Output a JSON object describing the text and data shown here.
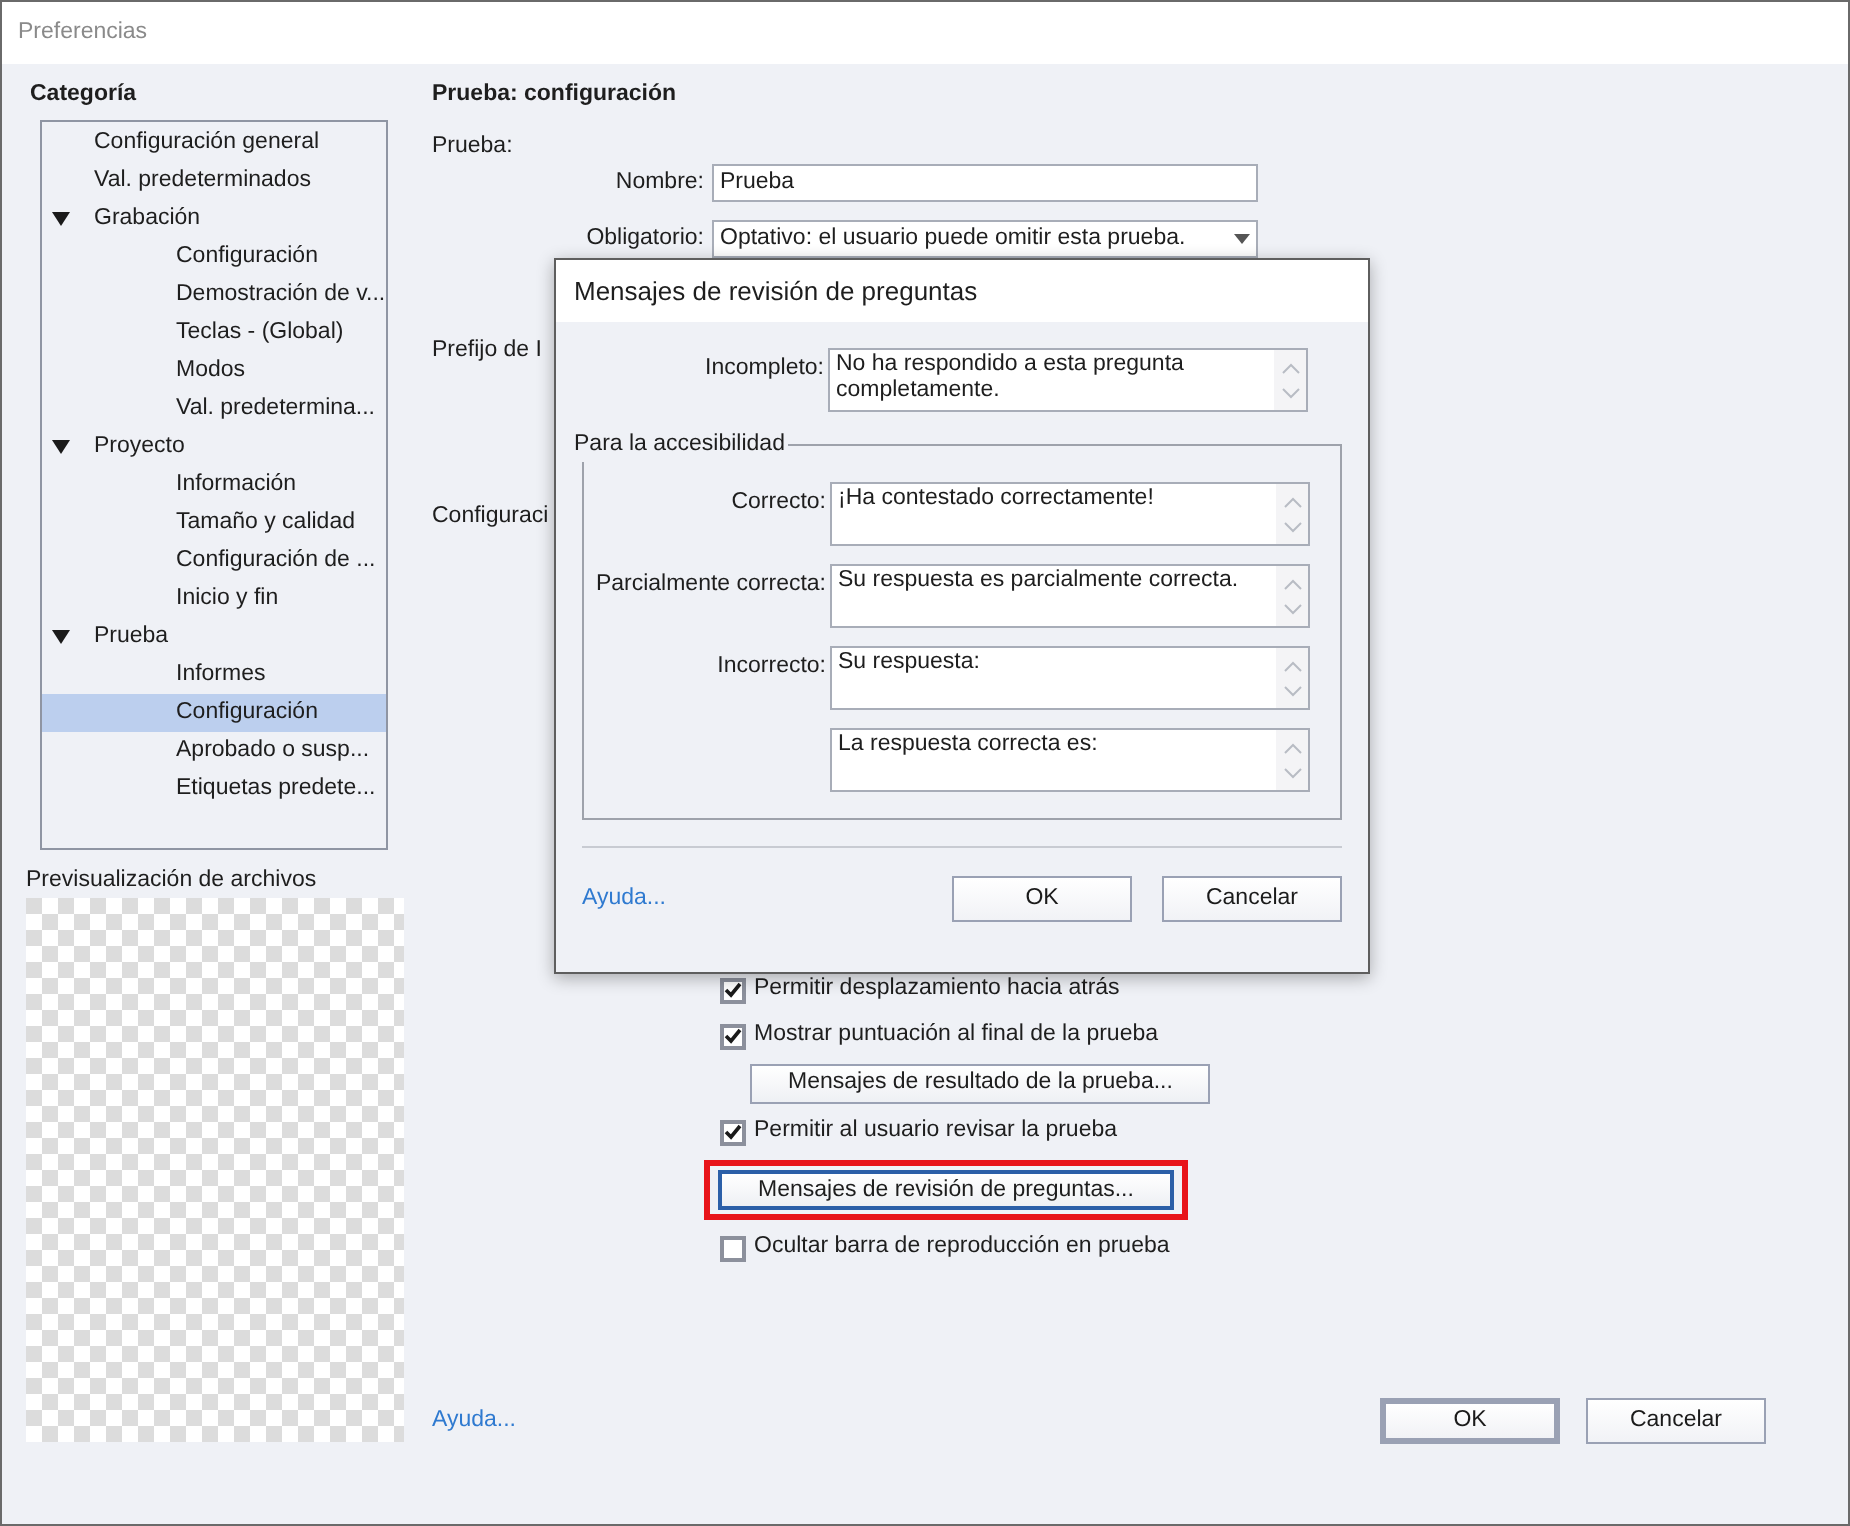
{
  "window": {
    "title": "Preferencias"
  },
  "sidebar": {
    "title": "Categoría",
    "tree": [
      {
        "label": "Configuración general",
        "selected": false
      },
      {
        "label": "Val. predeterminados",
        "selected": false
      },
      {
        "label": "Grabación",
        "selected": false,
        "expanded": true,
        "children": [
          {
            "label": "Configuración",
            "selected": false
          },
          {
            "label": "Demostración de v...",
            "selected": false
          },
          {
            "label": "Teclas - (Global)",
            "selected": false
          },
          {
            "label": "Modos",
            "selected": false
          },
          {
            "label": "Val. predetermina...",
            "selected": false
          }
        ]
      },
      {
        "label": "Proyecto",
        "selected": false,
        "expanded": true,
        "children": [
          {
            "label": "Información",
            "selected": false
          },
          {
            "label": "Tamaño y calidad",
            "selected": false
          },
          {
            "label": "Configuración de ...",
            "selected": false
          },
          {
            "label": "Inicio y fin",
            "selected": false
          }
        ]
      },
      {
        "label": "Prueba",
        "selected": false,
        "expanded": true,
        "children": [
          {
            "label": "Informes",
            "selected": false
          },
          {
            "label": "Configuración",
            "selected": true
          },
          {
            "label": "Aprobado o susp...",
            "selected": false
          },
          {
            "label": "Etiquetas predete...",
            "selected": false
          }
        ]
      }
    ]
  },
  "preview": {
    "title": "Previsualización de archivos"
  },
  "panel": {
    "title": "Prueba: configuración",
    "section_label": "Prueba:",
    "name_field": {
      "label": "Nombre:",
      "value": "Prueba"
    },
    "required_field": {
      "label": "Obligatorio:",
      "value": "Optativo: el usuario puede omitir esta prueba."
    },
    "prefix_label": "Prefijo de I",
    "settings_label": "Configuraci",
    "options": [
      {
        "kind": "checkbox",
        "label": "Permitir desplazamiento hacia atrás",
        "checked": true
      },
      {
        "kind": "checkbox",
        "label": "Mostrar puntuación al final de la prueba",
        "checked": true
      },
      {
        "kind": "button",
        "label": "Mensajes de resultado de la prueba...",
        "highlighted": false
      },
      {
        "kind": "checkbox",
        "label": "Permitir al usuario revisar la prueba",
        "checked": true
      },
      {
        "kind": "button",
        "label": "Mensajes de revisión de preguntas...",
        "highlighted": true
      },
      {
        "kind": "checkbox",
        "label": "Ocultar barra de reproducción en prueba",
        "checked": false
      }
    ],
    "help_link": "Ayuda...",
    "buttons": [
      {
        "label": "OK",
        "default": true
      },
      {
        "label": "Cancelar",
        "default": false
      }
    ]
  },
  "dialog": {
    "title": "Mensajes de revisión de preguntas",
    "incomplete": {
      "label": "Incompleto:",
      "value": "No ha respondido a esta pregunta completamente."
    },
    "group": {
      "legend": "Para la accesibilidad",
      "fields": [
        {
          "label": "Correcto:",
          "value": "¡Ha contestado correctamente!"
        },
        {
          "label": "Parcialmente correcta:",
          "value": "Su respuesta es parcialmente correcta."
        },
        {
          "label": "Incorrecto:",
          "value": "Su respuesta:"
        },
        {
          "value": "La respuesta correcta es:"
        }
      ]
    },
    "help_link": "Ayuda...",
    "buttons": [
      {
        "label": "OK",
        "default": false
      },
      {
        "label": "Cancelar",
        "default": false
      }
    ]
  }
}
